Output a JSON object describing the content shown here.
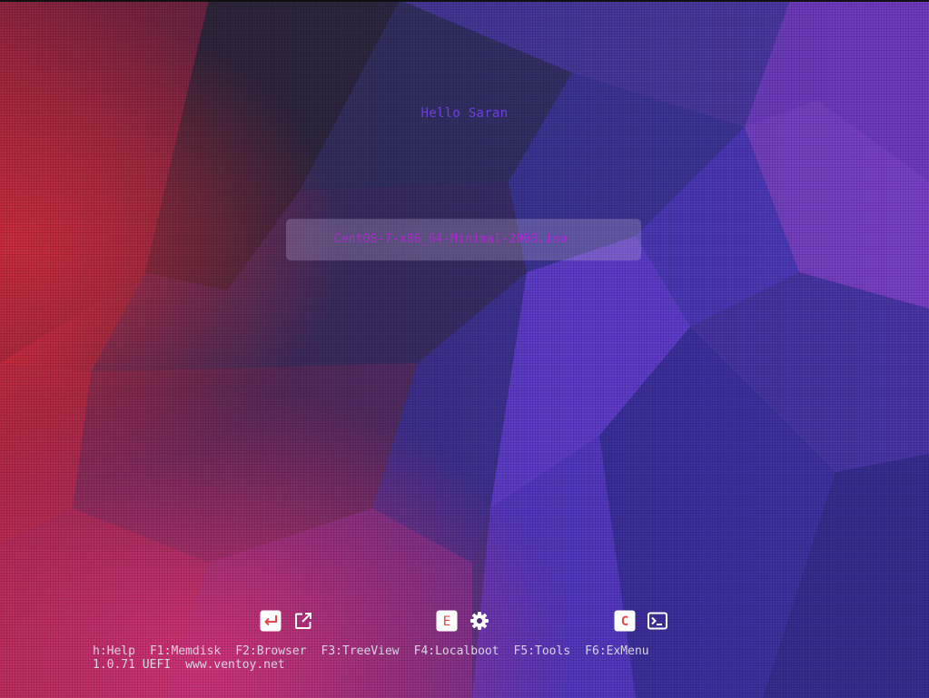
{
  "greeting": "Hello Saran",
  "boot_menu": {
    "items": [
      {
        "label": "CentOS-7-x86_64-Minimal-2003.iso",
        "selected": true
      }
    ]
  },
  "colors": {
    "greeting": "#6f3fe0",
    "menu_item_text": "#b325d4",
    "hint_text": "#d9d4e6"
  },
  "icons": {
    "group1": [
      "enter-icon",
      "external-link-icon"
    ],
    "group2": [
      "letter-e-icon",
      "gear-icon"
    ],
    "group3": [
      "letter-c-icon",
      "terminal-icon"
    ]
  },
  "icon_letters": {
    "e": "E",
    "c": "C"
  },
  "hotkeys": [
    "h:Help",
    "F1:Memdisk",
    "F2:Browser",
    "F3:TreeView",
    "F4:Localboot",
    "F5:Tools",
    "F6:ExMenu"
  ],
  "footer": {
    "version": "1.0.71 UEFI",
    "website": "www.ventoy.net"
  }
}
